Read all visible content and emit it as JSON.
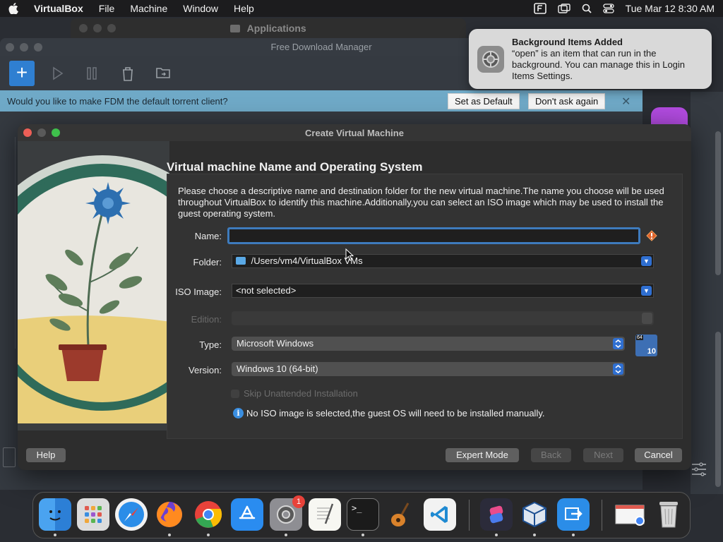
{
  "menubar": {
    "app_name": "VirtualBox",
    "items": [
      "File",
      "Machine",
      "Window",
      "Help"
    ],
    "clock": "Tue Mar 12  8:30 AM"
  },
  "applications_window": {
    "title": "Applications"
  },
  "fdm": {
    "title": "Free Download Manager",
    "banner_text": "Would you like to make FDM the default torrent client?",
    "set_default_label": "Set as Default",
    "dont_ask_label": "Don't ask again",
    "close_glyph": "✕"
  },
  "notification": {
    "title": "Background Items Added",
    "message": "“open” is an item that can run in the background. You can manage this in Login Items Settings."
  },
  "dialog": {
    "title": "Create Virtual Machine",
    "heading": "Virtual machine Name and Operating System",
    "description": "Please choose a descriptive name and destination folder for the new virtual machine.The name you choose will be used throughout VirtualBox to identify this machine.Additionally,you can select an ISO image which may be used to install the guest operating system.",
    "name_label": "Name:",
    "name_value": "",
    "folder_label": "Folder:",
    "folder_value": "/Users/vm4/VirtualBox VMs",
    "iso_label": "ISO Image:",
    "iso_value": "<not selected>",
    "edition_label": "Edition:",
    "edition_value": "",
    "type_label": "Type:",
    "type_value": "Microsoft Windows",
    "version_label": "Version:",
    "version_value": "Windows 10 (64-bit)",
    "os_badge_top": "64",
    "os_badge_bottom": "10",
    "skip_label": "Skip Unattended Installation",
    "info_text": "No ISO image is selected,the guest OS will need to be installed manually.",
    "help_label": "Help",
    "expert_label": "Expert Mode",
    "back_label": "Back",
    "next_label": "Next",
    "cancel_label": "Cancel"
  },
  "dock": {
    "settings_badge": "1",
    "apps": [
      "finder-icon",
      "launchpad-icon",
      "safari-icon",
      "firefox-icon",
      "chrome-icon",
      "app-store-icon",
      "system-settings-icon",
      "textedit-icon",
      "terminal-icon",
      "garageband-icon",
      "vscode-icon",
      "shortcuts-icon",
      "virtualbox-icon",
      "migration-assistant-icon",
      "downloads-stack-icon",
      "trash-icon"
    ]
  }
}
